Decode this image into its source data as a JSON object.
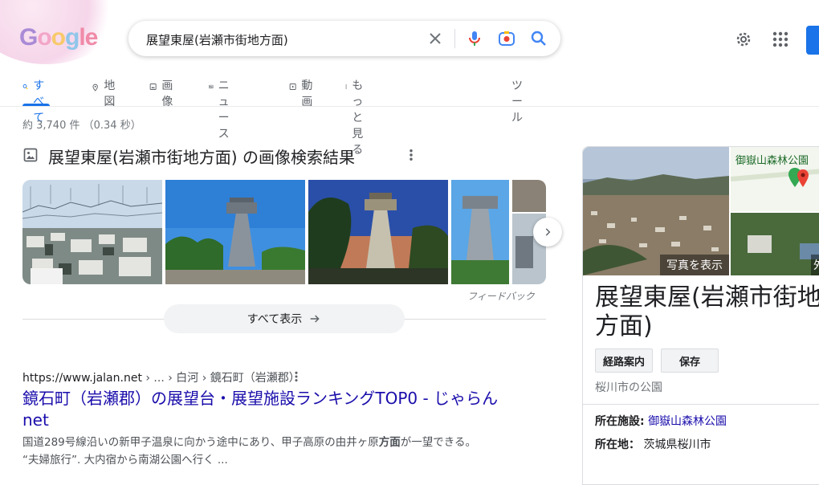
{
  "header": {
    "logo_text": "Google",
    "search_query": "展望東屋(岩瀬市街地方面)"
  },
  "tabs": [
    {
      "label": "すべて",
      "icon": "search-icon",
      "active": true
    },
    {
      "label": "地図",
      "icon": "map-pin-icon"
    },
    {
      "label": "画像",
      "icon": "image-icon"
    },
    {
      "label": "ニュース",
      "icon": "news-icon"
    },
    {
      "label": "動画",
      "icon": "video-icon"
    },
    {
      "label": "もっと見る",
      "icon": "more-vert-icon"
    },
    {
      "label": "ツール"
    }
  ],
  "stats": "約 3,740 件 （0.34 秒）",
  "images_section": {
    "title": "展望東屋(岩瀬市街地方面) の画像検索結果",
    "feedback": "フィードバック",
    "show_all": "すべて表示"
  },
  "result": {
    "url": "https://www.jalan.net",
    "breadcrumb": " › ... › 白河 › 鏡石町（岩瀬郡）",
    "title": "鏡石町（岩瀬郡）の展望台・展望施設ランキングTOP0 - じゃらんnet",
    "snippet_1a": "国道289号線沿いの新甲子温泉に向かう途中にあり、甲子高原の由井ヶ原",
    "snippet_1b": "方面",
    "snippet_1c": "が一望できる。",
    "snippet_2": "“夫婦旅行”. 大内宿から南湖公園へ行く ..."
  },
  "knowledge_panel": {
    "show_photos": "写真を表示",
    "map_label": "御嶽山森林公園",
    "overlay_char": "外",
    "title": "展望東屋(岩瀬市街地方面)",
    "chip_directions": "経路案内",
    "chip_save": "保存",
    "subtitle": "桜川市の公園",
    "facility_label": "所在施設:",
    "facility_value": "御嶽山森林公園",
    "address_label": "所在地：",
    "address_value": "茨城県桜川市"
  }
}
